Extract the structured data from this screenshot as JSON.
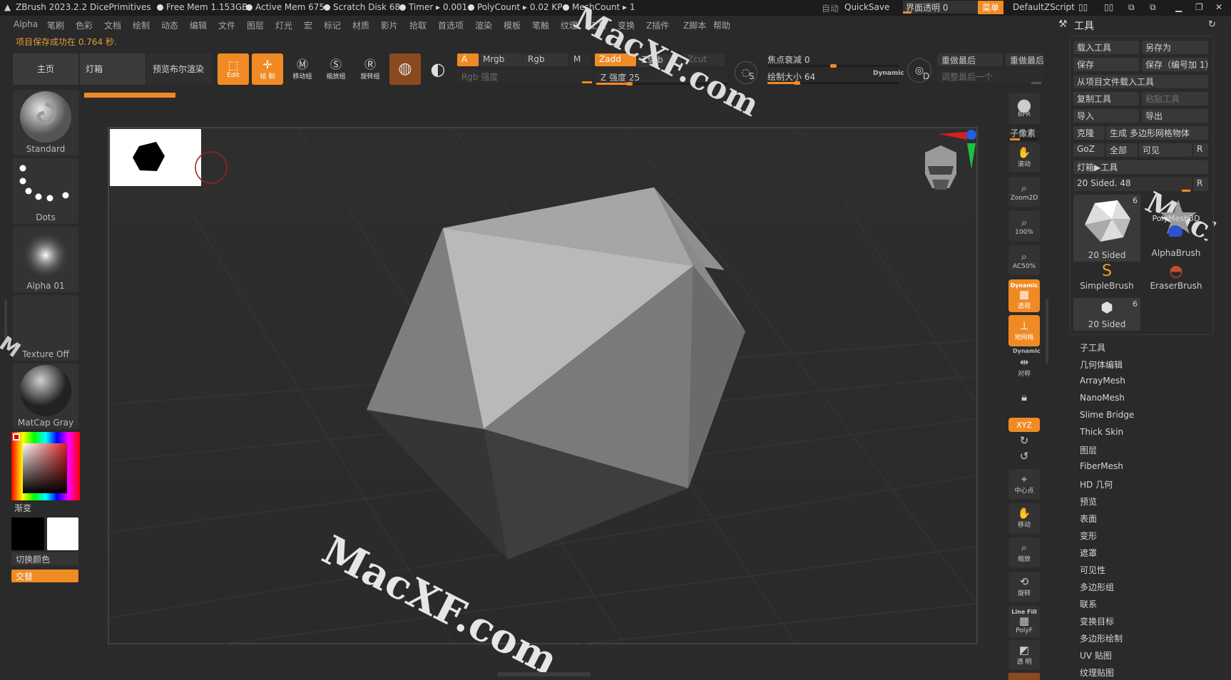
{
  "title_bar": {
    "app": "ZBrush 2023.2.2",
    "document": "DicePrimitives",
    "stats": [
      "Free Mem 1.153GB",
      "Active Mem 675",
      "Scratch Disk 68",
      "Timer ▸ 0.001",
      "PolyCount ▸ 0.02 KP",
      "MeshCount ▸ 1"
    ],
    "auto": "自动",
    "quicksave": "QuickSave",
    "transparency": "界面透明 0",
    "menu_btn": "菜单",
    "script": "DefaultZScript"
  },
  "menu": [
    "Alpha",
    "笔刷",
    "色彩",
    "文档",
    "绘制",
    "动态",
    "编辑",
    "文件",
    "图层",
    "灯光",
    "宏",
    "标记",
    "材质",
    "影片",
    "拾取",
    "首选项",
    "渲染",
    "模板",
    "笔触",
    "纹理",
    "工具",
    "变换",
    "Z插件",
    "Z脚本",
    "帮助"
  ],
  "notice": "项目保存成功在 0.764 秒.",
  "top_tabs": {
    "home": "主页",
    "lightbox": "灯箱",
    "preview": "预览布尔渲染"
  },
  "tools": {
    "edit": "Edit",
    "draw": "绘 制",
    "move": "移动组",
    "scale": "缩放组",
    "rotate": "旋转组"
  },
  "channels": {
    "a": "A",
    "mrgb": "Mrgb",
    "rgb": "Rgb",
    "m": "M",
    "zadd": "Zadd",
    "zsub": "Zsub",
    "zcut": "Zcut",
    "rgb_intensity": "Rgb 强度",
    "z_intensity": "Z 强度 25",
    "focal_shift": "焦点衰减 0",
    "draw_size": "绘制大小 64",
    "dynamic": "Dynamic",
    "s": "S",
    "d": "D",
    "redo_last": "重做最后",
    "redo_last2": "重做最后",
    "adjust_last": "调整最后一个"
  },
  "levels": {
    "z_intensity": 25,
    "focal_shift": 0,
    "draw_size": 64
  },
  "left_panel": {
    "brush": "Standard",
    "stroke": "Dots",
    "alpha": "Alpha 01",
    "texture": "Texture Off",
    "material": "MatCap Gray",
    "gradient": "渐变",
    "switch_color": "切换颜色",
    "alternate": "交替"
  },
  "right_toolbar": {
    "bpr": "BPR",
    "subpixel": "子像素",
    "scroll": "滚动",
    "zoom2d": "Zoom2D",
    "actual": "100%",
    "ac50": "AC50%",
    "dynamic": "Dynamic",
    "persp": "透视",
    "floor": "地网格",
    "dynamic2": "Dynamic",
    "sym": "对称",
    "xyz": "XYZ",
    "center": "中心点",
    "move": "移动",
    "zoom": "缩放",
    "rotate": "旋转",
    "linefill": "Line Fill",
    "polyf": "PolyF",
    "transp": "透 明"
  },
  "tool_panel": {
    "title": "工具",
    "load": "载入工具",
    "save_as": "另存为",
    "save": "保存",
    "save_inc": "保存（编号加 1）",
    "load_project": "从项目文件载入工具",
    "copy": "复制工具",
    "paste": "粘贴工具",
    "import": "导入",
    "export": "导出",
    "clone": "克隆",
    "make_polymesh": "生成 多边形网格物体",
    "goz": "GoZ",
    "all": "全部",
    "visible": "可见",
    "r": "R",
    "lightbox_tool": "灯箱▶工具",
    "current": "20 Sided. 48",
    "current_r": "R",
    "thumbs": [
      {
        "label": "20 Sided",
        "count": "6"
      },
      {
        "label": "PolyMesh3D",
        "count": ""
      },
      {
        "label": "AlphaBrush",
        "count": ""
      },
      {
        "label": "SimpleBrush",
        "count": ""
      },
      {
        "label": "EraserBrush",
        "count": ""
      },
      {
        "label": "20 Sided",
        "count": "6"
      }
    ],
    "subpalettes": [
      "子工具",
      "几何体编辑",
      "ArrayMesh",
      "NanoMesh",
      "Slime Bridge",
      "Thick Skin",
      "图层",
      "FiberMesh",
      "HD 几何",
      "预览",
      "表面",
      "变形",
      "遮罩",
      "可见性",
      "多边形组",
      "联系",
      "变换目标",
      "多边形绘制",
      "UV 贴图",
      "纹理贴图"
    ]
  },
  "watermark": "MacXF.com",
  "colors": {
    "accent": "#f08a24",
    "panel": "#2a2a2a",
    "dark": "#1c1c1c"
  }
}
